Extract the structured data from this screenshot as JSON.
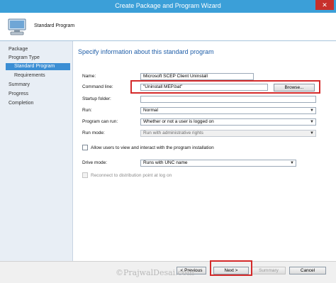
{
  "window": {
    "title": "Create Package and Program Wizard",
    "close_glyph": "✕"
  },
  "header": {
    "title": "Standard Program",
    "icon": "computer-icon"
  },
  "nav": {
    "items": [
      {
        "label": "Package"
      },
      {
        "label": "Program Type"
      },
      {
        "label": "Standard Program"
      },
      {
        "label": "Requirements"
      },
      {
        "label": "Summary"
      },
      {
        "label": "Progress"
      },
      {
        "label": "Completion"
      }
    ]
  },
  "content": {
    "heading": "Specify information about this standard program"
  },
  "form": {
    "name": {
      "label": "Name:",
      "value": "Microsoft SCEP Client Uninstall"
    },
    "command_line": {
      "label": "Command line:",
      "value": "\"Uninstall MEP.bat\"",
      "browse_label": "Browse..."
    },
    "startup_folder": {
      "label": "Startup folder:",
      "value": ""
    },
    "run": {
      "label": "Run:",
      "value": "Normal"
    },
    "program_can_run": {
      "label": "Program can run:",
      "value": "Whether or not a user is logged on"
    },
    "run_mode": {
      "label": "Run mode:",
      "value": "Run with administrative rights"
    },
    "allow_interact": {
      "label": "Allow users to view and interact with the program installation"
    },
    "drive_mode": {
      "label": "Drive mode:",
      "value": "Runs with UNC name"
    },
    "reconnect": {
      "label": "Reconnect to distribution point at log on"
    }
  },
  "footer": {
    "previous_label": "< Previous",
    "next_label": "Next >",
    "summary_label": "Summary",
    "cancel_label": "Cancel",
    "watermark": "©PrajwalDesai.com"
  },
  "colors": {
    "titlebar": "#3b9fd8",
    "heading": "#1f5ea8",
    "nav_active": "#3b8ed4",
    "highlight": "#d42a2a"
  }
}
